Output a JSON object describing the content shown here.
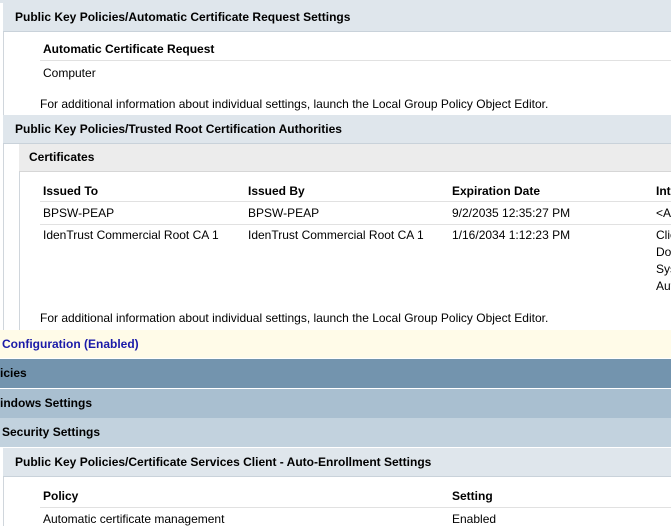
{
  "auto_cert": {
    "title": "Public Key Policies/Automatic Certificate Request Settings",
    "col_header": "Automatic Certificate Request",
    "value": "Computer",
    "note": "For additional information about individual settings, launch the Local Group Policy Object Editor."
  },
  "trusted_root": {
    "title": "Public Key Policies/Trusted Root Certification Authorities",
    "sub_title": "Certificates",
    "columns": [
      "Issued To",
      "Issued By",
      "Expiration Date",
      "Int"
    ],
    "rows": [
      {
        "issued_to": "BPSW-PEAP",
        "issued_by": "BPSW-PEAP",
        "expiration": "9/2/2035 12:35:27 PM",
        "intended": [
          "<Al"
        ]
      },
      {
        "issued_to": "IdenTrust Commercial Root CA 1",
        "issued_by": "IdenTrust Commercial Root CA 1",
        "expiration": "1/16/2034 1:12:23 PM",
        "intended": [
          "Clie",
          "Do",
          "Sys",
          "Aut"
        ]
      }
    ],
    "note": "For additional information about individual settings, launch the Local Group Policy Object Editor."
  },
  "config_bar": "Configuration (Enabled)",
  "policies_bar": "icies",
  "windows_settings_bar": "indows Settings",
  "security_settings_bar": "Security Settings",
  "auto_enroll": {
    "title": "Public Key Policies/Certificate Services Client - Auto-Enrollment Settings",
    "columns": [
      "Policy",
      "Setting"
    ],
    "rows": [
      {
        "policy": "Automatic certificate management",
        "setting": "Enabled"
      }
    ]
  }
}
